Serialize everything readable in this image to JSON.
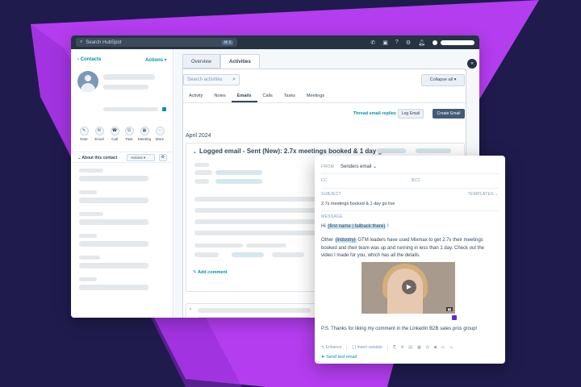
{
  "topbar": {
    "search_placeholder": "Search HubSpot",
    "shortcut": "⌘ K",
    "icons": [
      "phone-icon",
      "marketplace-icon",
      "help-icon",
      "settings-icon",
      "bell-icon"
    ]
  },
  "left": {
    "back_label": "Contacts",
    "actions_label": "Actions",
    "quick_actions": [
      {
        "label": "Note",
        "glyph": "✎"
      },
      {
        "label": "Email",
        "glyph": "✉"
      },
      {
        "label": "Call",
        "glyph": "☎"
      },
      {
        "label": "Task",
        "glyph": "☑"
      },
      {
        "label": "Meeting",
        "glyph": "▦"
      },
      {
        "label": "More",
        "glyph": "···"
      }
    ],
    "about_label": "About this contact",
    "about_actions": "Actions"
  },
  "main": {
    "tabs": [
      {
        "label": "Overview"
      },
      {
        "label": "Activities"
      }
    ],
    "search_placeholder": "Search activities",
    "collapse_all": "Collapse all",
    "subtabs": [
      "Activity",
      "Notes",
      "Emails",
      "Calls",
      "Tasks",
      "Meetings"
    ],
    "thread_replies": "Thread email replies",
    "log_email": "Log Email",
    "create_email": "Create Email",
    "month": "April 2024",
    "email_card_title": "Logged email - Sent (New): 2.7x meetings booked & 1 day go live",
    "add_comment": "Add comment"
  },
  "email": {
    "from_label": "FROM",
    "from_value": "Senders email",
    "cc_label": "CC",
    "bcc_label": "BCC",
    "subject_label": "SUBJECT",
    "templates_label": "TEMPLATES",
    "subject_value": "2.7x meetings booked & 1 day go live",
    "message_label": "MESSAGE",
    "greeting_prefix": "Hi ",
    "greeting_token": "{first name | fallback:there}",
    "greeting_suffix": " !",
    "para1_prefix": "Other ",
    "para1_token": "{industry}",
    "para1_rest": " GTM leaders have used Mixmax to get 2.7x their meetings booked and their team was up and running in less than 1 day. Check out the video I made for you, which has all the details.",
    "ps": "P.S. Thanks for liking my comment in the LinkedIn B2B sales pros group!",
    "enhance": "Enhance",
    "insert_variable": "Insert variable",
    "send_test": "Send test email"
  }
}
